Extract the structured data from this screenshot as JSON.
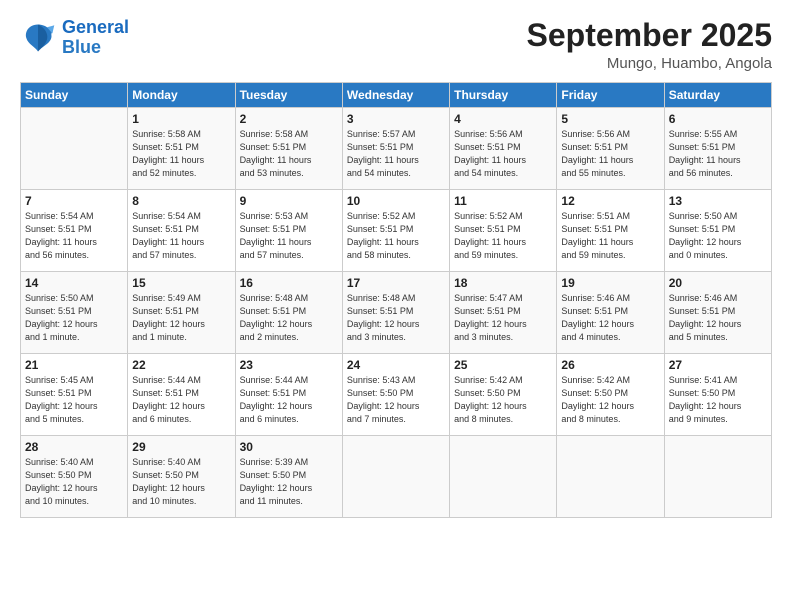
{
  "logo": {
    "line1": "General",
    "line2": "Blue"
  },
  "title": "September 2025",
  "subtitle": "Mungo, Huambo, Angola",
  "days_header": [
    "Sunday",
    "Monday",
    "Tuesday",
    "Wednesday",
    "Thursday",
    "Friday",
    "Saturday"
  ],
  "weeks": [
    [
      {
        "num": "",
        "info": ""
      },
      {
        "num": "1",
        "info": "Sunrise: 5:58 AM\nSunset: 5:51 PM\nDaylight: 11 hours\nand 52 minutes."
      },
      {
        "num": "2",
        "info": "Sunrise: 5:58 AM\nSunset: 5:51 PM\nDaylight: 11 hours\nand 53 minutes."
      },
      {
        "num": "3",
        "info": "Sunrise: 5:57 AM\nSunset: 5:51 PM\nDaylight: 11 hours\nand 54 minutes."
      },
      {
        "num": "4",
        "info": "Sunrise: 5:56 AM\nSunset: 5:51 PM\nDaylight: 11 hours\nand 54 minutes."
      },
      {
        "num": "5",
        "info": "Sunrise: 5:56 AM\nSunset: 5:51 PM\nDaylight: 11 hours\nand 55 minutes."
      },
      {
        "num": "6",
        "info": "Sunrise: 5:55 AM\nSunset: 5:51 PM\nDaylight: 11 hours\nand 56 minutes."
      }
    ],
    [
      {
        "num": "7",
        "info": "Sunrise: 5:54 AM\nSunset: 5:51 PM\nDaylight: 11 hours\nand 56 minutes."
      },
      {
        "num": "8",
        "info": "Sunrise: 5:54 AM\nSunset: 5:51 PM\nDaylight: 11 hours\nand 57 minutes."
      },
      {
        "num": "9",
        "info": "Sunrise: 5:53 AM\nSunset: 5:51 PM\nDaylight: 11 hours\nand 57 minutes."
      },
      {
        "num": "10",
        "info": "Sunrise: 5:52 AM\nSunset: 5:51 PM\nDaylight: 11 hours\nand 58 minutes."
      },
      {
        "num": "11",
        "info": "Sunrise: 5:52 AM\nSunset: 5:51 PM\nDaylight: 11 hours\nand 59 minutes."
      },
      {
        "num": "12",
        "info": "Sunrise: 5:51 AM\nSunset: 5:51 PM\nDaylight: 11 hours\nand 59 minutes."
      },
      {
        "num": "13",
        "info": "Sunrise: 5:50 AM\nSunset: 5:51 PM\nDaylight: 12 hours\nand 0 minutes."
      }
    ],
    [
      {
        "num": "14",
        "info": "Sunrise: 5:50 AM\nSunset: 5:51 PM\nDaylight: 12 hours\nand 1 minute."
      },
      {
        "num": "15",
        "info": "Sunrise: 5:49 AM\nSunset: 5:51 PM\nDaylight: 12 hours\nand 1 minute."
      },
      {
        "num": "16",
        "info": "Sunrise: 5:48 AM\nSunset: 5:51 PM\nDaylight: 12 hours\nand 2 minutes."
      },
      {
        "num": "17",
        "info": "Sunrise: 5:48 AM\nSunset: 5:51 PM\nDaylight: 12 hours\nand 3 minutes."
      },
      {
        "num": "18",
        "info": "Sunrise: 5:47 AM\nSunset: 5:51 PM\nDaylight: 12 hours\nand 3 minutes."
      },
      {
        "num": "19",
        "info": "Sunrise: 5:46 AM\nSunset: 5:51 PM\nDaylight: 12 hours\nand 4 minutes."
      },
      {
        "num": "20",
        "info": "Sunrise: 5:46 AM\nSunset: 5:51 PM\nDaylight: 12 hours\nand 5 minutes."
      }
    ],
    [
      {
        "num": "21",
        "info": "Sunrise: 5:45 AM\nSunset: 5:51 PM\nDaylight: 12 hours\nand 5 minutes."
      },
      {
        "num": "22",
        "info": "Sunrise: 5:44 AM\nSunset: 5:51 PM\nDaylight: 12 hours\nand 6 minutes."
      },
      {
        "num": "23",
        "info": "Sunrise: 5:44 AM\nSunset: 5:51 PM\nDaylight: 12 hours\nand 6 minutes."
      },
      {
        "num": "24",
        "info": "Sunrise: 5:43 AM\nSunset: 5:50 PM\nDaylight: 12 hours\nand 7 minutes."
      },
      {
        "num": "25",
        "info": "Sunrise: 5:42 AM\nSunset: 5:50 PM\nDaylight: 12 hours\nand 8 minutes."
      },
      {
        "num": "26",
        "info": "Sunrise: 5:42 AM\nSunset: 5:50 PM\nDaylight: 12 hours\nand 8 minutes."
      },
      {
        "num": "27",
        "info": "Sunrise: 5:41 AM\nSunset: 5:50 PM\nDaylight: 12 hours\nand 9 minutes."
      }
    ],
    [
      {
        "num": "28",
        "info": "Sunrise: 5:40 AM\nSunset: 5:50 PM\nDaylight: 12 hours\nand 10 minutes."
      },
      {
        "num": "29",
        "info": "Sunrise: 5:40 AM\nSunset: 5:50 PM\nDaylight: 12 hours\nand 10 minutes."
      },
      {
        "num": "30",
        "info": "Sunrise: 5:39 AM\nSunset: 5:50 PM\nDaylight: 12 hours\nand 11 minutes."
      },
      {
        "num": "",
        "info": ""
      },
      {
        "num": "",
        "info": ""
      },
      {
        "num": "",
        "info": ""
      },
      {
        "num": "",
        "info": ""
      }
    ]
  ]
}
